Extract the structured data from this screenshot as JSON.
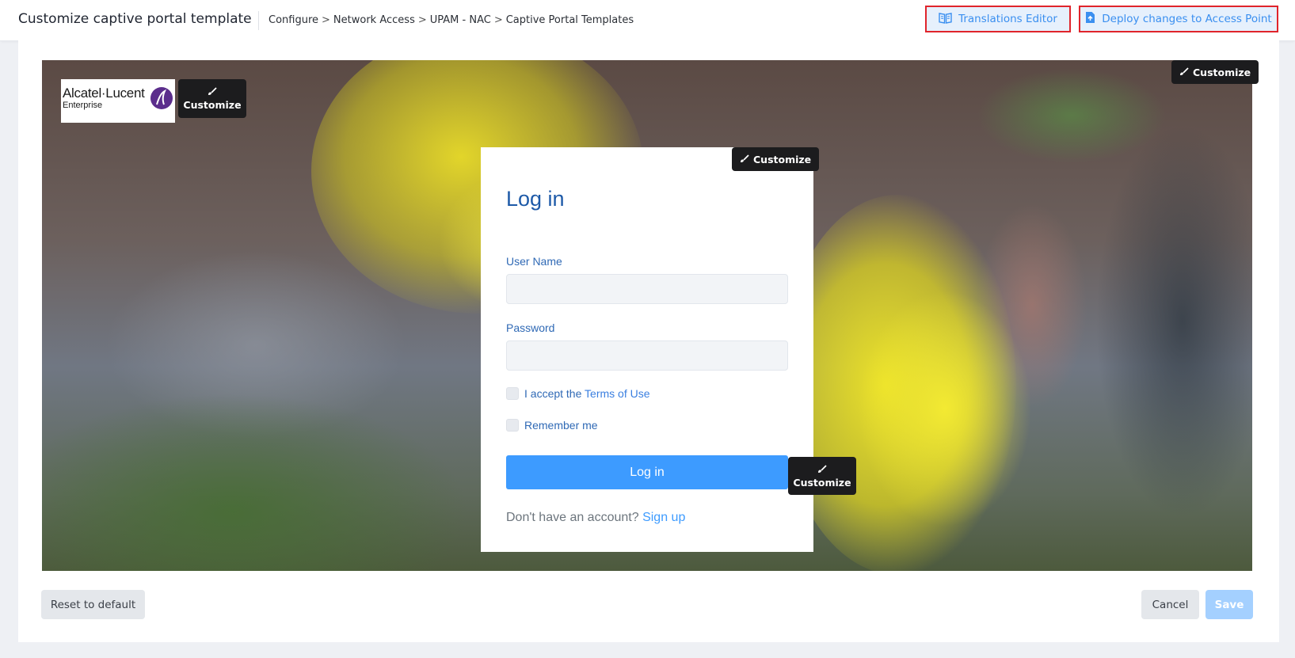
{
  "header": {
    "title": "Customize captive portal template",
    "breadcrumb": [
      "Configure",
      "Network Access",
      "UPAM - NAC",
      "Captive Portal Templates"
    ],
    "breadcrumb_separator": ">",
    "translations_label": "Translations Editor",
    "deploy_label": "Deploy changes to Access Point",
    "accent_color": "#3a8ff0",
    "highlight_color": "#e0242b"
  },
  "preview": {
    "logo": {
      "line1": "Alcatel·Lucent",
      "line2": "Enterprise"
    },
    "customize_label": "Customize",
    "login": {
      "title": "Log in",
      "username_label": "User Name",
      "username_value": "",
      "password_label": "Password",
      "password_value": "",
      "accept_prefix": "I accept the",
      "terms_link": "Terms of Use",
      "remember_label": "Remember me",
      "login_button": "Log in",
      "no_account": "Don't have an account?",
      "signup_link": "Sign up",
      "button_color": "#3d9bff",
      "title_color": "#1e5aa8"
    }
  },
  "footer": {
    "reset_label": "Reset to default",
    "cancel_label": "Cancel",
    "save_label": "Save"
  }
}
